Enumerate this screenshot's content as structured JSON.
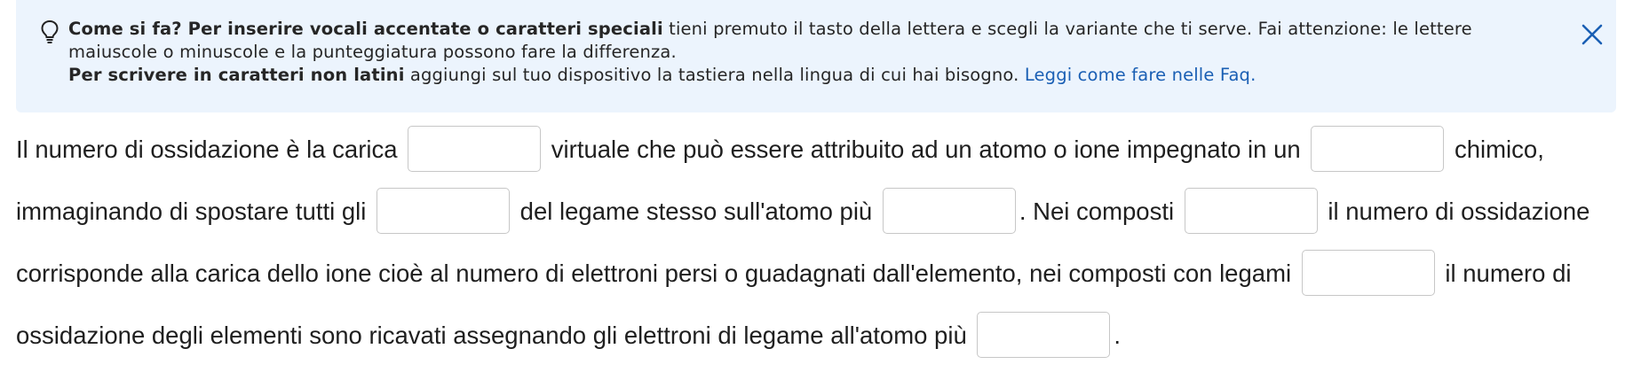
{
  "hint": {
    "line1_bold": "Come si fa? Per inserire vocali accentate o caratteri speciali",
    "line1_rest": " tieni premuto il tasto della lettera e scegli la variante che ti serve. Fai attenzione: le lettere maiuscole o minuscole e la punteggiatura possono fare la differenza.",
    "line2_bold": "Per scrivere in caratteri non latini",
    "line2_rest": " aggiungi sul tuo dispositivo la tastiera nella lingua di cui hai bisogno. ",
    "link": "Leggi come fare nelle Faq.",
    "icon": "lightbulb-icon",
    "close_icon": "close-icon",
    "accent_color": "#1a5fb4",
    "background_color": "#ecf4fd"
  },
  "exercise": {
    "line1": {
      "t1": "Il numero di ossidazione è la carica ",
      "t2": " virtuale che può essere attribuito ad un atomo o ione impegnato in un ",
      "t3": " chimico,"
    },
    "line2": {
      "t1": "immaginando di spostare tutti gli ",
      "t2": " del legame stesso sull'atomo più ",
      "t3": ". Nei composti ",
      "t4": " il numero di ossidazione"
    },
    "line3": {
      "t1": "corrisponde alla carica dello ione cioè al numero di elettroni persi o guadagnati dall'elemento, nei composti con legami ",
      "t2": " il numero di"
    },
    "line4": {
      "t1": "ossidazione degli elementi sono ricavati assegnando gli elettroni di legame all'atomo più ",
      "t2": "."
    },
    "blanks": [
      "",
      "",
      "",
      "",
      "",
      "",
      ""
    ]
  }
}
